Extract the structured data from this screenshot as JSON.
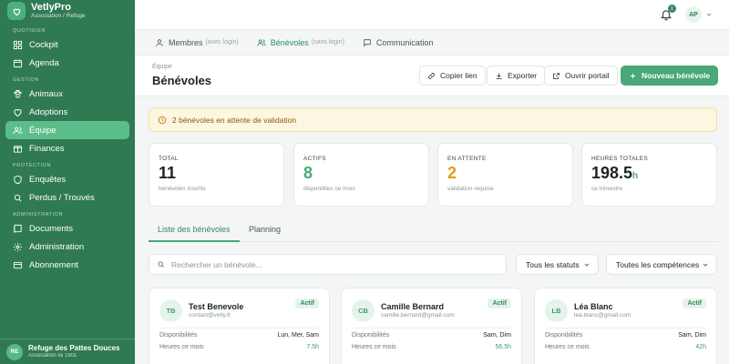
{
  "brand": {
    "name": "VetlyPro",
    "subtitle": "Association / Refuge"
  },
  "sidebar": {
    "sections": [
      {
        "title": "QUOTIDIEN"
      },
      {
        "title": "GESTION"
      },
      {
        "title": "PROTECTION"
      },
      {
        "title": "ADMINISTRATION"
      }
    ],
    "items": [
      {
        "label": "Cockpit",
        "icon": "grid-icon"
      },
      {
        "label": "Agenda",
        "icon": "calendar-icon"
      },
      {
        "label": "Animaux",
        "icon": "paw-icon"
      },
      {
        "label": "Adoptions",
        "icon": "heart-icon"
      },
      {
        "label": "Équipe",
        "icon": "users-icon",
        "active": true
      },
      {
        "label": "Finances",
        "icon": "wallet-icon"
      },
      {
        "label": "Enquêtes",
        "icon": "shield-icon"
      },
      {
        "label": "Perdus / Trouvés",
        "icon": "search-icon"
      },
      {
        "label": "Documents",
        "icon": "book-icon"
      },
      {
        "label": "Administration",
        "icon": "gear-icon"
      },
      {
        "label": "Abonnement",
        "icon": "card-icon"
      }
    ],
    "org": {
      "initials": "RE",
      "name": "Refuge des Pattes Douces",
      "subtitle": "Association loi 1901"
    }
  },
  "topbar": {
    "notification_count": "1",
    "user_initials": "AP"
  },
  "tabs": [
    {
      "label": "Membres",
      "hint": "(avec login)"
    },
    {
      "label": "Bénévoles",
      "hint": "(sans login)",
      "active": true
    },
    {
      "label": "Communication",
      "hint": ""
    }
  ],
  "header": {
    "breadcrumb": "Équipe",
    "title": "Bénévoles",
    "buttons": {
      "copy_link": "Copier lien",
      "export": "Exporter",
      "open_portal": "Ouvrir portail",
      "new_volunteer": "Nouveau bénévole"
    }
  },
  "alert": {
    "text": "2 bénévoles en attente de validation"
  },
  "stats": [
    {
      "label": "TOTAL",
      "value": "11",
      "unit": "",
      "sub": "bénévoles inscrits",
      "color": "#1c2421"
    },
    {
      "label": "ACTIFS",
      "value": "8",
      "unit": "",
      "sub": "disponibles ce mois",
      "color": "#48a877"
    },
    {
      "label": "EN ATTENTE",
      "value": "2",
      "unit": "",
      "sub": "validation requise",
      "color": "#e59a1a"
    },
    {
      "label": "HEURES TOTALES",
      "value": "198.5",
      "unit": "h",
      "sub": "ce trimestre",
      "color": "#1c2421"
    }
  ],
  "list_tabs": {
    "list": "Liste des bénévoles",
    "planning": "Planning"
  },
  "filters": {
    "search_placeholder": "Rechercher un bénévole...",
    "status": "Tous les statuts",
    "skills": "Toutes les compétences"
  },
  "volunteers": [
    {
      "initials": "TB",
      "name": "Test Benevole",
      "email": "contact@vetly.fr",
      "status": "Actif",
      "availability_label": "Disponibilités",
      "availability": "Lun, Mer, Sam",
      "hours_label": "Heures ce mois",
      "hours": "7.5h"
    },
    {
      "initials": "CB",
      "name": "Camille Bernard",
      "email": "camille.bernard@gmail.com",
      "status": "Actif",
      "availability_label": "Disponibilités",
      "availability": "Sam, Dim",
      "hours_label": "Heures ce mois",
      "hours": "56.5h"
    },
    {
      "initials": "LB",
      "name": "Léa Blanc",
      "email": "lea.blanc@gmail.com",
      "status": "Actif",
      "availability_label": "Disponibilités",
      "availability": "Sam, Dim",
      "hours_label": "Heures ce mois",
      "hours": "42h"
    }
  ],
  "colors": {
    "sidebar": "#2f7a52",
    "accent": "#48a877",
    "active_nav": "#5bbd8a",
    "warning": "#e59a1a"
  }
}
